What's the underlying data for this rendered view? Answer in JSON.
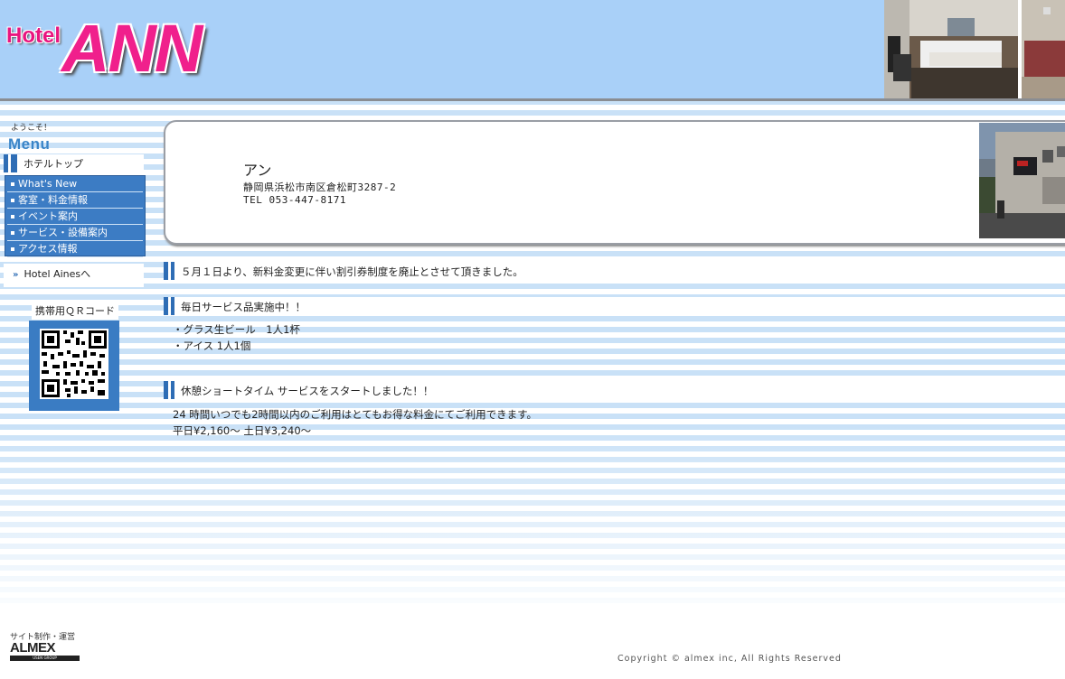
{
  "header": {
    "logo_hotel": "Hotel",
    "logo_name": "ANN"
  },
  "sidebar": {
    "welcome": "ようこそ！",
    "menu_title": "Menu",
    "top_link": "ホテルトップ",
    "items": [
      {
        "label": "What's New"
      },
      {
        "label": "客室・料金情報"
      },
      {
        "label": "イベント案内"
      },
      {
        "label": "サービス・設備案内"
      },
      {
        "label": "アクセス情報"
      }
    ],
    "external_link": "Hotel Ainesへ",
    "qr_label": "携帯用ＱＲコード"
  },
  "info": {
    "name": "アン",
    "address": "静岡県浜松市南区倉松町3287-2",
    "tel": "TEL 053-447-8171"
  },
  "sections": [
    {
      "title": "５月１日より、新料金変更に伴い割引券制度を廃止とさせて頂きました。",
      "lines": []
    },
    {
      "title": "毎日サービス品実施中！！",
      "lines": [
        "・グラス生ビール　1人1杯",
        "・アイス 1人1個"
      ]
    },
    {
      "title": "休憩ショートタイム サービスをスタートしました！！",
      "lines": [
        "24 時間いつでも2時間以内のご利用はとてもお得な料金にてご利用できます。",
        "平日¥2,160～ 土日¥3,240～"
      ]
    }
  ],
  "footer": {
    "operator_label": "サイト制作・運営",
    "operator_logo": "ALMEX",
    "operator_sub": "USEN GROUP",
    "copyright": "Copyright © almex inc, All Rights Reserved"
  },
  "colors": {
    "header_bg": "#a9d0f8",
    "logo_pink": "#f0208c",
    "menu_blue": "#3c7cc4"
  }
}
